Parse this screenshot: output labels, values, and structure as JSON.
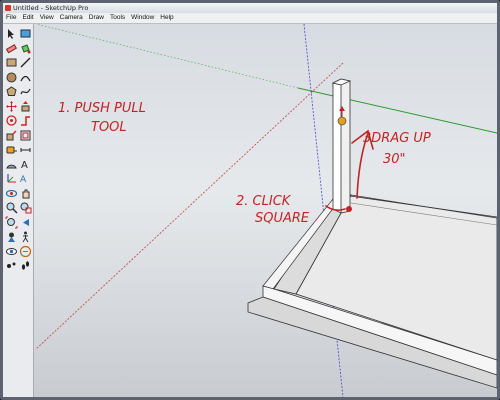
{
  "window": {
    "title": "Untitled - SketchUp Pro"
  },
  "menu": [
    "File",
    "Edit",
    "View",
    "Camera",
    "Draw",
    "Tools",
    "Window",
    "Help"
  ],
  "toolbar_icons": [
    "select-icon",
    "component-icon",
    "eraser-icon",
    "paint-bucket-icon",
    "rectangle-icon",
    "line-icon",
    "circle-icon",
    "arc-icon",
    "polygon-icon",
    "freehand-icon",
    "move-icon",
    "push-pull-icon",
    "rotate-icon",
    "follow-me-icon",
    "scale-icon",
    "offset-icon",
    "tape-measure-icon",
    "dimension-icon",
    "protractor-icon",
    "text-icon",
    "axes-icon",
    "3d-text-icon",
    "orbit-icon",
    "pan-icon",
    "zoom-icon",
    "zoom-window-icon",
    "zoom-extents-icon",
    "previous-view-icon",
    "position-camera-icon",
    "walk-icon",
    "look-around-icon",
    "section-plane-icon",
    "sandbox-icon",
    "footprints-icon"
  ],
  "annotations": {
    "step1_line1": "1. PUSH PULL",
    "step1_line2": "TOOL",
    "step2_line1": "2. CLICK",
    "step2_line2": "SQUARE",
    "step3_line1": "3DRAG UP",
    "step3_line2": "30\""
  },
  "colors": {
    "annotation": "#c22424",
    "axis_red": "#c23a3a",
    "axis_green": "#2e9a2e",
    "axis_blue": "#4040c8"
  }
}
